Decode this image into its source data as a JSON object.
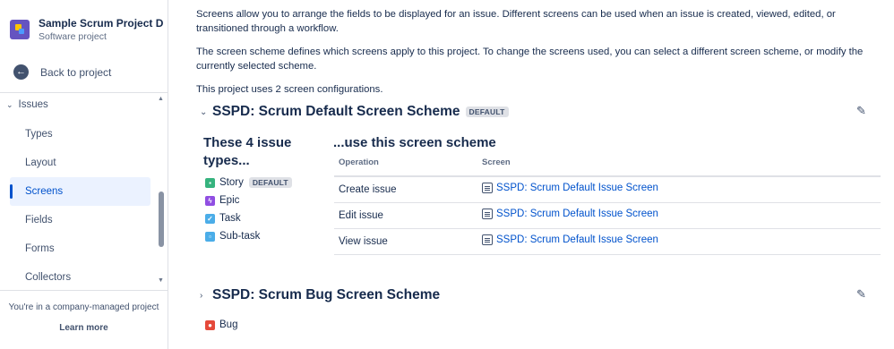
{
  "sidebar": {
    "project_name": "Sample Scrum Project D",
    "project_type": "Software project",
    "back_label": "Back to project",
    "group_label": "Issues",
    "items": [
      {
        "label": "Types",
        "active": false
      },
      {
        "label": "Layout",
        "active": false
      },
      {
        "label": "Screens",
        "active": true
      },
      {
        "label": "Fields",
        "active": false
      },
      {
        "label": "Forms",
        "active": false
      },
      {
        "label": "Collectors",
        "active": false
      }
    ],
    "footer_text": "You're in a company-managed project",
    "learn_more": "Learn more"
  },
  "main": {
    "intro": "Screens allow you to arrange the fields to be displayed for an issue. Different screens can be used when an issue is created, viewed, edited, or transitioned through a workflow.",
    "scheme_info": "The screen scheme defines which screens apply to this project. To change the screens used, you can select a different screen scheme, or modify the currently selected scheme.",
    "config_count": "This project uses 2 screen configurations.",
    "schemes": [
      {
        "title": "SSPD: Scrum Default Screen Scheme",
        "badge": "DEFAULT",
        "types_title": "These 4 issue types...",
        "use_title": "...use this screen scheme",
        "issue_types": [
          {
            "label": "Story",
            "badge": "DEFAULT",
            "icon": "story-icon",
            "color": "#36b37e"
          },
          {
            "label": "Epic",
            "icon": "epic-icon",
            "color": "#904ee2"
          },
          {
            "label": "Task",
            "icon": "task-icon",
            "color": "#4bade8"
          },
          {
            "label": "Sub-task",
            "icon": "subtask-icon",
            "color": "#4bade8"
          }
        ],
        "table": {
          "headers": {
            "operation": "Operation",
            "screen": "Screen"
          },
          "rows": [
            {
              "operation": "Create issue",
              "screen": "SSPD: Scrum Default Issue Screen"
            },
            {
              "operation": "Edit issue",
              "screen": "SSPD: Scrum Default Issue Screen"
            },
            {
              "operation": "View issue",
              "screen": "SSPD: Scrum Default Issue Screen"
            }
          ]
        }
      },
      {
        "title": "SSPD: Scrum Bug Screen Scheme",
        "issue_types": [
          {
            "label": "Bug",
            "icon": "bug-icon",
            "color": "#e5493a"
          }
        ]
      }
    ]
  }
}
